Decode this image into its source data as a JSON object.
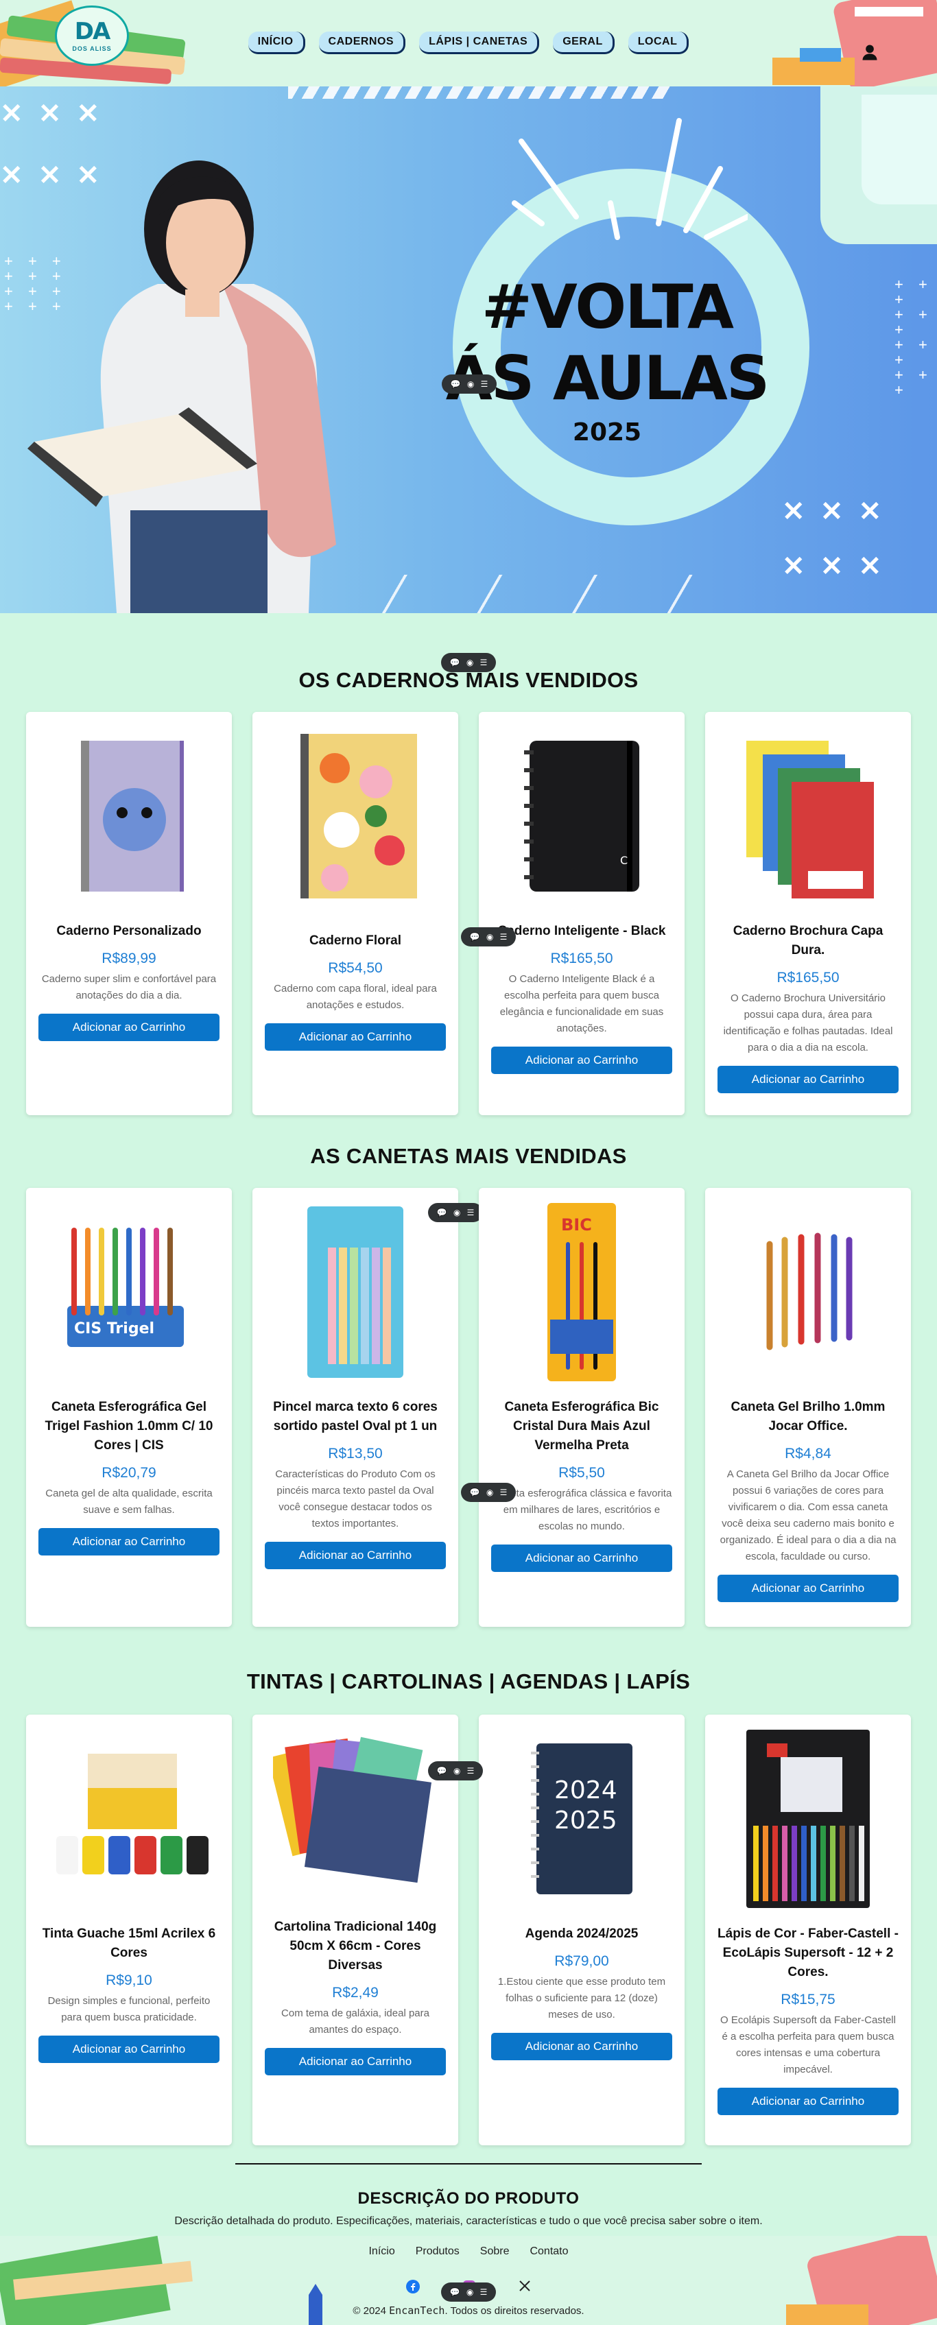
{
  "brand": {
    "logo_mark": "DA",
    "logo_sub": "DOS ALISS"
  },
  "nav": {
    "items": [
      {
        "label": "INÍCIO"
      },
      {
        "label": "CADERNOS"
      },
      {
        "label": "LÁPIS | CANETAS"
      },
      {
        "label": "GERAL"
      },
      {
        "label": "LOCAL"
      }
    ]
  },
  "hero": {
    "line1": "#VOLTA",
    "line2": "ÁS AULAS",
    "year": "2025"
  },
  "sections": [
    {
      "title": "OS CADERNOS MAIS VENDIDOS",
      "products": [
        {
          "name": "Caderno Personalizado",
          "price": "R$89,99",
          "desc": "Caderno super slim e confortável para anotações do dia a dia.",
          "button": "Adicionar ao Carrinho"
        },
        {
          "name": "Caderno Floral",
          "price": "R$54,50",
          "desc": "Caderno com capa floral, ideal para anotações e estudos.",
          "button": "Adicionar ao Carrinho"
        },
        {
          "name": "Caderno Inteligente - Black",
          "price": "R$165,50",
          "desc": "O Caderno Inteligente Black é a escolha perfeita para quem busca elegância e funcionalidade em suas anotações.",
          "button": "Adicionar ao Carrinho"
        },
        {
          "name": "Caderno Brochura Capa Dura.",
          "price": "R$165,50",
          "desc": "O Caderno Brochura Universitário possui capa dura, área para identificação e folhas pautadas. Ideal para o dia a dia na escola.",
          "button": "Adicionar ao Carrinho"
        }
      ]
    },
    {
      "title": "AS CANETAS MAIS VENDIDAS",
      "products": [
        {
          "name": "Caneta Esferográfica Gel Trigel Fashion 1.0mm C/ 10 Cores | CIS",
          "price": "R$20,79",
          "desc": "Caneta gel de alta qualidade, escrita suave e sem falhas.",
          "button": "Adicionar ao Carrinho"
        },
        {
          "name": "Pincel marca texto 6 cores sortido pastel Oval pt 1 un",
          "price": "R$13,50",
          "desc": "Características do Produto Com os pincéis marca texto pastel da Oval você consegue destacar todos os textos importantes.",
          "button": "Adicionar ao Carrinho"
        },
        {
          "name": "Caneta Esferográfica Bic Cristal Dura Mais Azul Vermelha Preta",
          "price": "R$5,50",
          "desc": "Caneta esferográfica clássica e favorita em milhares de lares, escritórios e escolas no mundo.",
          "button": "Adicionar ao Carrinho"
        },
        {
          "name": "Caneta Gel Brilho 1.0mm Jocar Office.",
          "price": "R$4,84",
          "desc": "A Caneta Gel Brilho da Jocar Office possui 6 variações de cores para vivificarem o dia. Com essa caneta você deixa seu caderno mais bonito e organizado. É ideal para o dia a dia na escola, faculdade ou curso.",
          "button": "Adicionar ao Carrinho"
        }
      ]
    },
    {
      "title": "TINTAS | CARTOLINAS | AGENDAS | LAPÍS",
      "products": [
        {
          "name": "Tinta Guache 15ml Acrilex 6 Cores",
          "price": "R$9,10",
          "desc": "Design simples e funcional, perfeito para quem busca praticidade.",
          "button": "Adicionar ao Carrinho"
        },
        {
          "name": "Cartolina Tradicional 140g 50cm X 66cm - Cores Diversas",
          "price": "R$2,49",
          "desc": "Com tema de galáxia, ideal para amantes do espaço.",
          "button": "Adicionar ao Carrinho"
        },
        {
          "name": "Agenda 2024/2025",
          "price": "R$79,00",
          "desc": "1.Estou ciente que esse produto tem folhas o suficiente para 12 (doze) meses de uso.",
          "button": "Adicionar ao Carrinho"
        },
        {
          "name": "Lápis de Cor - Faber-Castell - EcoLápis Supersoft - 12 + 2 Cores.",
          "price": "R$15,75",
          "desc": "O Ecolápis Supersoft da Faber-Castell é a escolha perfeita para quem busca cores intensas e uma cobertura impecável.",
          "button": "Adicionar ao Carrinho"
        }
      ]
    }
  ],
  "description": {
    "title": "DESCRIÇÃO DO PRODUTO",
    "text": "Descrição detalhada do produto. Especificações, materiais, características e tudo o que você precisa saber sobre o item."
  },
  "footer": {
    "links": [
      {
        "label": "Início"
      },
      {
        "label": "Produtos"
      },
      {
        "label": "Sobre"
      },
      {
        "label": "Contato"
      }
    ],
    "social": [
      "facebook-icon",
      "instagram-icon",
      "x-icon"
    ],
    "copy_prefix": "© 2024 ",
    "copy_brand": "EncanTech",
    "copy_suffix": ". Todos os direitos reservados."
  },
  "colors": {
    "accent": "#0a75c9",
    "price": "#1f7fd4",
    "background": "#d1f7e2"
  }
}
